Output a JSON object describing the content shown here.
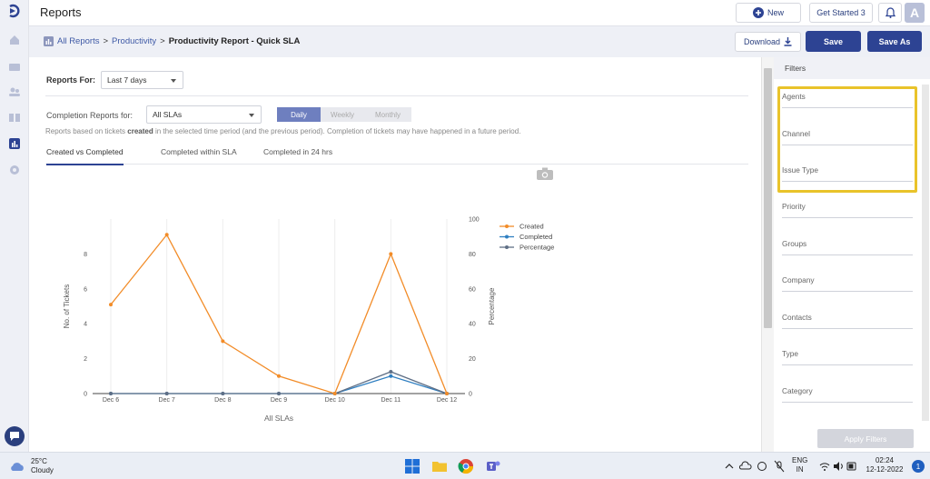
{
  "header": {
    "title": "Reports",
    "new_label": "New",
    "get_started_label": "Get Started 3",
    "avatar_letter": "A"
  },
  "breadcrumb": {
    "all_reports": "All Reports",
    "sep": ">",
    "productivity": "Productivity",
    "current": "Productivity Report - Quick SLA"
  },
  "actions": {
    "download_label": "Download",
    "save_label": "Save",
    "save_as_label": "Save As"
  },
  "report": {
    "reports_for_label": "Reports For:",
    "reports_for_value": "Last 7 days",
    "completion_label": "Completion Reports for:",
    "completion_value": "All SLAs",
    "periods": [
      "Daily",
      "Weekly",
      "Monthly"
    ],
    "active_period": "Daily",
    "note_pre": "Reports based on tickets ",
    "note_bold": "created",
    "note_post": " in the selected time period (and the previous period). Completion of tickets may have happened in a future period.",
    "tabs": [
      "Created vs Completed",
      "Completed within SLA",
      "Completed in 24 hrs"
    ],
    "active_tab": "Created vs Completed"
  },
  "chart_data": {
    "type": "line",
    "categories": [
      "Dec 6",
      "Dec 7",
      "Dec 8",
      "Dec 9",
      "Dec 10",
      "Dec 11",
      "Dec 12"
    ],
    "series": [
      {
        "name": "Created",
        "axis": "left",
        "values": [
          5.1,
          9.1,
          3.0,
          1.0,
          0,
          8.0,
          0
        ],
        "color": "#f28c28"
      },
      {
        "name": "Completed",
        "axis": "left",
        "values": [
          0,
          0,
          0,
          0,
          0,
          1.0,
          0
        ],
        "color": "#2f7fc1"
      },
      {
        "name": "Percentage",
        "axis": "right",
        "values": [
          0,
          0,
          0,
          0,
          0,
          12.5,
          0
        ],
        "color": "#5f6f86"
      }
    ],
    "xlabel": "All SLAs",
    "ylabel": "No. of Tickets",
    "y2label": "Percentage",
    "yticks": [
      0,
      2,
      4,
      6,
      8
    ],
    "y2ticks": [
      0,
      20,
      40,
      60,
      80,
      100
    ],
    "ylim": [
      0,
      10
    ],
    "y2lim": [
      0,
      100
    ],
    "legend_position": "top-right",
    "grid": "vertical"
  },
  "filters": {
    "title": "Filters",
    "fields": [
      "Agents",
      "Channel",
      "Issue Type",
      "Priority",
      "Groups",
      "Company",
      "Contacts",
      "Type",
      "Category"
    ],
    "apply_label": "Apply Filters"
  },
  "taskbar": {
    "temp": "25°C",
    "condition": "Cloudy",
    "lang_top": "ENG",
    "lang_bottom": "IN",
    "time": "02:24",
    "date": "12-12-2022",
    "notifications": "1"
  },
  "colors": {
    "primary": "#2d4393",
    "highlight": "#e9c32a",
    "created": "#f28c28",
    "completed": "#2f7fc1",
    "percentage": "#5f6f86"
  }
}
